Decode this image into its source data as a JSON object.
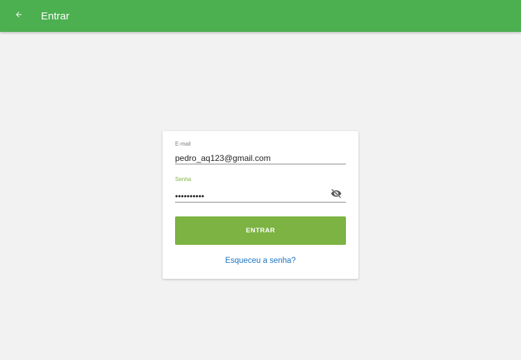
{
  "appbar": {
    "title": "Entrar",
    "back_icon": "arrow-left-icon",
    "color": "#4caf50"
  },
  "login_form": {
    "email": {
      "label": "E-mail",
      "value": "pedro_aq123@gmail.com"
    },
    "password": {
      "label": "Senha",
      "value": "••••••••••",
      "visibility_icon": "eye-off-icon"
    },
    "submit_label": "ENTRAR",
    "submit_color": "#7cb342",
    "forgot_password_label": "Esqueceu a senha?",
    "link_color": "#1a73c2"
  }
}
